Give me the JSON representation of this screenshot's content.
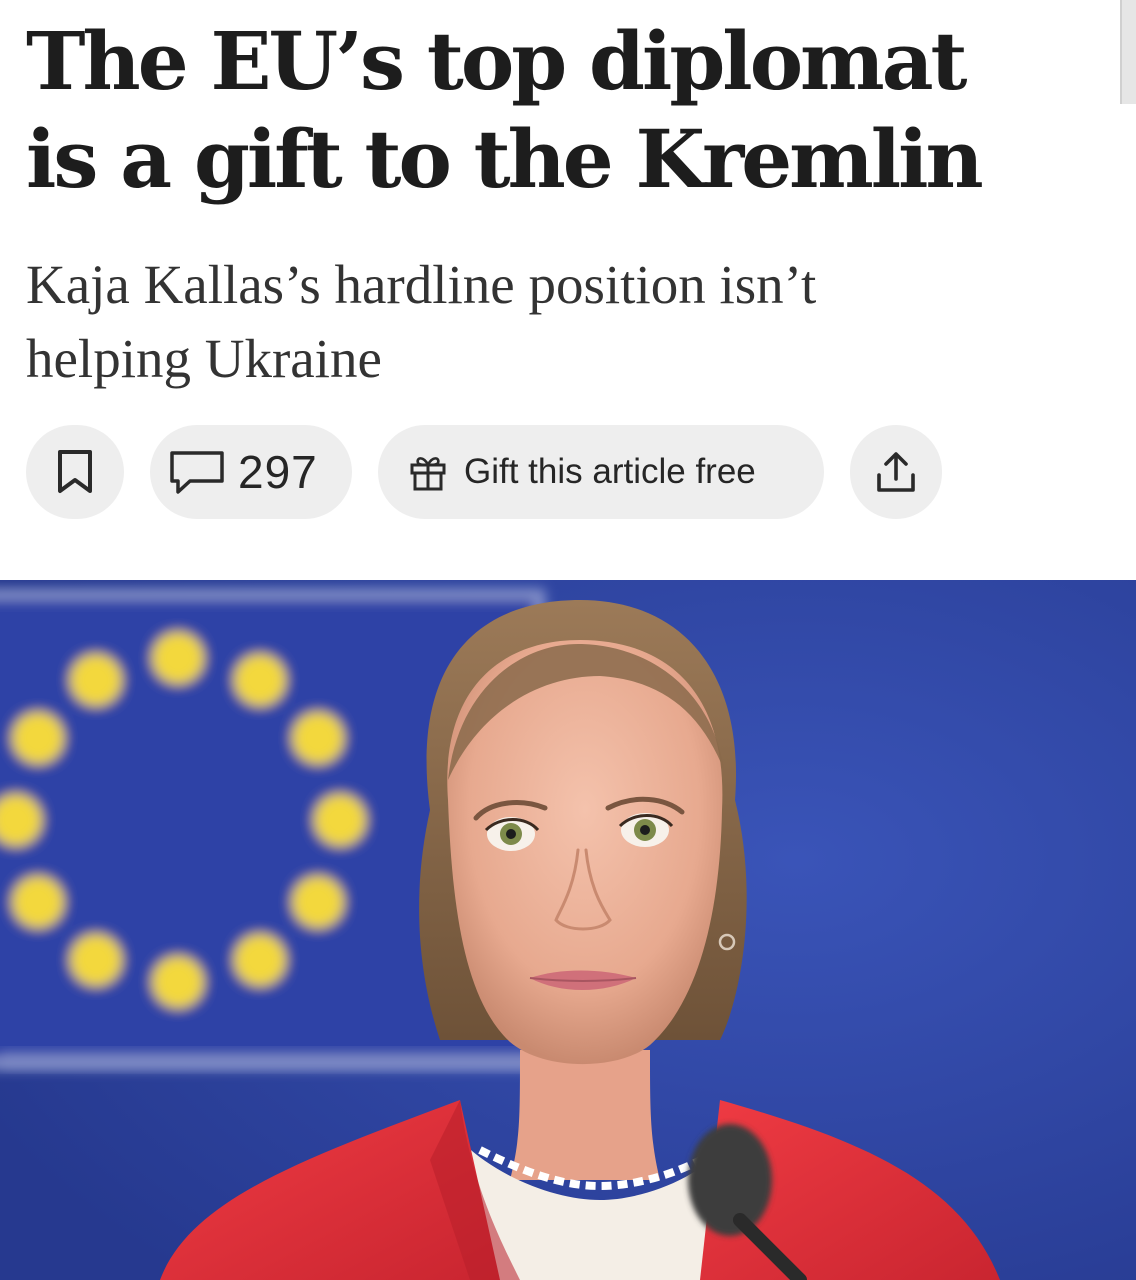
{
  "article": {
    "headline_line1": "The EU’s top diplomat",
    "headline_line2": "is a gift to the Kremlin",
    "standfirst_line1": "Kaja Kallas’s hardline position isn’t",
    "standfirst_line2": "helping Ukraine"
  },
  "actions": {
    "bookmark_icon": "bookmark-icon",
    "comment_icon": "speech-bubble-icon",
    "comment_count": "297",
    "gift_icon": "gift-icon",
    "gift_label": "Gift this article free",
    "share_icon": "share-upload-icon"
  },
  "colors": {
    "flag_blue": "#2f43a6",
    "star_yellow": "#f3d83c",
    "jacket_red": "#e8323a",
    "pill_grey": "#eeeeee"
  }
}
